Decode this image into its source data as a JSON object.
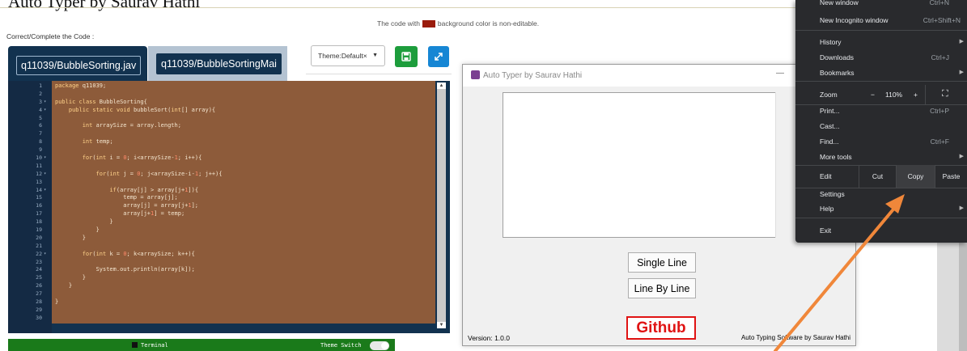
{
  "caption": {
    "text": "Auto Typer by Saurav Hathi"
  },
  "editor": {
    "note_before": "The code with",
    "note_after": "background color is non-editable.",
    "instruction": "Correct/Complete the Code :",
    "tabs": [
      {
        "label": "q11039/BubbleSorting.jav"
      },
      {
        "label": "q11039/BubbleSortingMai"
      }
    ],
    "theme_select": "Theme:Default×",
    "colors": {
      "non_editable_bg": "#8d5b3a",
      "editor_bg": "#12324f",
      "save_green": "#1d9d3c",
      "expand_blue": "#1686d4"
    },
    "lines": [
      {
        "n": "1",
        "fold": "",
        "code": "package q11039;"
      },
      {
        "n": "2",
        "fold": "",
        "code": ""
      },
      {
        "n": "3",
        "fold": "▾",
        "code": "public class BubbleSorting{"
      },
      {
        "n": "4",
        "fold": "▾",
        "code": "    public static void bubbleSort(int[] array){"
      },
      {
        "n": "5",
        "fold": "",
        "code": ""
      },
      {
        "n": "6",
        "fold": "",
        "code": "        int arraySize = array.length;"
      },
      {
        "n": "7",
        "fold": "",
        "code": ""
      },
      {
        "n": "8",
        "fold": "",
        "code": "        int temp;"
      },
      {
        "n": "9",
        "fold": "",
        "code": ""
      },
      {
        "n": "10",
        "fold": "▾",
        "code": "        for(int i = 0; i<arraySize-1; i++){"
      },
      {
        "n": "11",
        "fold": "",
        "code": ""
      },
      {
        "n": "12",
        "fold": "▾",
        "code": "            for(int j = 0; j<arraySize-i-1; j++){"
      },
      {
        "n": "13",
        "fold": "",
        "code": ""
      },
      {
        "n": "14",
        "fold": "▾",
        "code": "                if(array[j] > array[j+1]){"
      },
      {
        "n": "15",
        "fold": "",
        "code": "                    temp = array[j];"
      },
      {
        "n": "16",
        "fold": "",
        "code": "                    array[j] = array[j+1];"
      },
      {
        "n": "17",
        "fold": "",
        "code": "                    array[j+1] = temp;"
      },
      {
        "n": "18",
        "fold": "",
        "code": "                }"
      },
      {
        "n": "19",
        "fold": "",
        "code": "            }"
      },
      {
        "n": "20",
        "fold": "",
        "code": "        }"
      },
      {
        "n": "21",
        "fold": "",
        "code": ""
      },
      {
        "n": "22",
        "fold": "▾",
        "code": "        for(int k = 0; k<arraySize; k++){"
      },
      {
        "n": "23",
        "fold": "",
        "code": ""
      },
      {
        "n": "24",
        "fold": "",
        "code": "            System.out.println(array[k]);"
      },
      {
        "n": "25",
        "fold": "",
        "code": "        }"
      },
      {
        "n": "26",
        "fold": "",
        "code": "    }"
      },
      {
        "n": "27",
        "fold": "",
        "code": ""
      },
      {
        "n": "28",
        "fold": "",
        "code": "}"
      },
      {
        "n": "29",
        "fold": "",
        "code": ""
      },
      {
        "n": "30",
        "fold": "",
        "code": ""
      }
    ],
    "terminal_label": "Terminal",
    "theme_switch_label": "Theme Switch"
  },
  "autotyper": {
    "title": "Auto Typer by Saurav Hathi",
    "minimize": "—",
    "single_line": "Single Line",
    "line_by_line": "Line By Line",
    "github": "Github",
    "version": "Version: 1.0.0",
    "footer": "Auto Typing Software by Saurav Hathi",
    "colors": {
      "github_red": "#e01313"
    }
  },
  "chrome_menu": {
    "cut_top": {
      "label": "New window",
      "shortcut": "Ctrl+N"
    },
    "new_incognito": {
      "label": "New Incognito window",
      "shortcut": "Ctrl+Shift+N"
    },
    "history": "History",
    "downloads": {
      "label": "Downloads",
      "shortcut": "Ctrl+J"
    },
    "bookmarks": "Bookmarks",
    "zoom": {
      "label": "Zoom",
      "minus": "−",
      "value": "110%",
      "plus": "+"
    },
    "print": {
      "label": "Print...",
      "shortcut": "Ctrl+P"
    },
    "cast": "Cast...",
    "find": {
      "label": "Find...",
      "shortcut": "Ctrl+F"
    },
    "more_tools": "More tools",
    "edit": {
      "label": "Edit",
      "cut": "Cut",
      "copy": "Copy",
      "paste": "Paste"
    },
    "settings": "Settings",
    "help": "Help",
    "exit": "Exit",
    "colors": {
      "bg": "#292a2d",
      "copy_highlight": "#3c3d40"
    }
  },
  "annotation": {
    "arrow_color": "#f0873a"
  }
}
